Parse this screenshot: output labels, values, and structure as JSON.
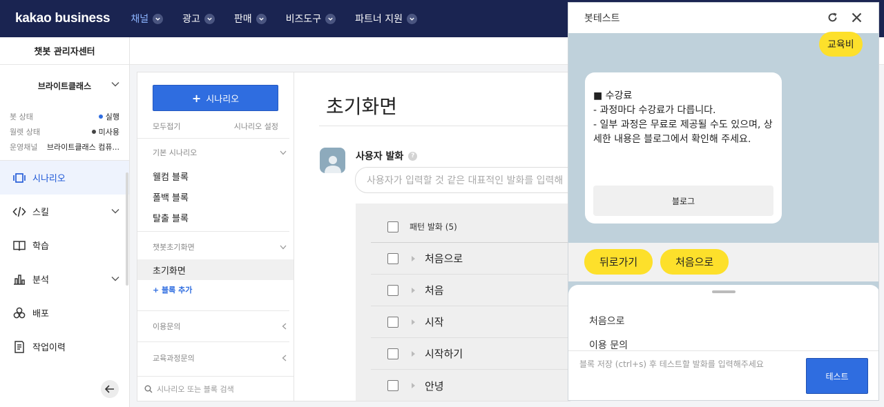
{
  "topnav": {
    "brand": "kakao business",
    "items": [
      {
        "label": "채널",
        "active": true
      },
      {
        "label": "광고",
        "active": false
      },
      {
        "label": "판매",
        "active": false
      },
      {
        "label": "비즈도구",
        "active": false
      },
      {
        "label": "파트너 지원",
        "active": false
      }
    ]
  },
  "sidebar": {
    "title": "챗봇 관리자센터",
    "bot_name": "브라이트클래스",
    "info": [
      {
        "key": "봇 상태",
        "value": "실행",
        "dot_color": "#2f6de0"
      },
      {
        "key": "월렛 상태",
        "value": "미사용",
        "dot_color": "#444444"
      },
      {
        "key": "운영채널",
        "value": "브라이트클래스 컴퓨..."
      }
    ],
    "menu": [
      {
        "label": "시나리오",
        "icon": "scenario-icon",
        "active": true
      },
      {
        "label": "스킬",
        "icon": "code-icon",
        "expandable": true
      },
      {
        "label": "학습",
        "icon": "book-icon"
      },
      {
        "label": "분석",
        "icon": "chart-icon",
        "expandable": true
      },
      {
        "label": "배포",
        "icon": "deploy-icon"
      },
      {
        "label": "작업이력",
        "icon": "history-icon"
      }
    ]
  },
  "scenario_panel": {
    "add_button": "시나리오",
    "collapse_all": "모두접기",
    "settings": "시나리오 설정",
    "groups": [
      {
        "title": "기본 시나리오",
        "blocks": [
          "웰컴 블록",
          "폴백 블록",
          "탈출 블록"
        ]
      },
      {
        "title": "챗봇초기화면",
        "blocks": [
          "초기화면"
        ],
        "add_block": "+ 블록 추가"
      },
      {
        "title": "이용문의"
      },
      {
        "title": "교육과정문의"
      }
    ],
    "search_placeholder": "시나리오 또는 블록 검색"
  },
  "editor": {
    "title": "초기화면",
    "user_utterance_label": "사용자 발화",
    "help": "?",
    "utterance_placeholder": "사용자가 입력할 것 같은 대표적인 발화를 입력해",
    "pattern_header": "패턴 발화 (5)",
    "patterns": [
      "처음으로",
      "처음",
      "시작",
      "시작하기",
      "안녕"
    ]
  },
  "bot_test": {
    "title": "봇테스트",
    "user_message": "교육비",
    "card_text": "■ 수강료\n- 과정마다 수강료가 다릅니다.\n- 일부 과정은 무료로 제공될 수도 있으며, 상세한 내용은 블로그에서 확인해 주세요.",
    "card_button": "블로그",
    "quick_replies": [
      "뒤로가기",
      "처음으로"
    ],
    "sheet_items": [
      "처음으로",
      "이용 문의"
    ],
    "input_placeholder": "블록 저장 (ctrl+s) 후 테스트할 발화를 입력해주세요",
    "test_button": "테스트"
  }
}
